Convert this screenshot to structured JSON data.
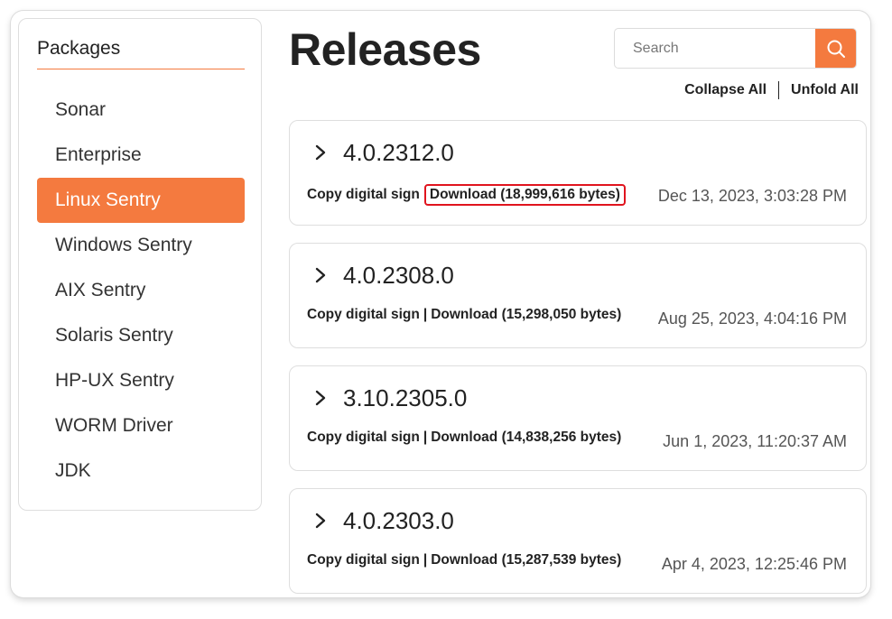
{
  "sidebar": {
    "title": "Packages",
    "items": [
      {
        "label": "Sonar",
        "active": false
      },
      {
        "label": "Enterprise",
        "active": false
      },
      {
        "label": "Linux Sentry",
        "active": true
      },
      {
        "label": "Windows Sentry",
        "active": false
      },
      {
        "label": "AIX Sentry",
        "active": false
      },
      {
        "label": "Solaris Sentry",
        "active": false
      },
      {
        "label": "HP-UX Sentry",
        "active": false
      },
      {
        "label": "WORM Driver",
        "active": false
      },
      {
        "label": "JDK",
        "active": false
      }
    ]
  },
  "header": {
    "title": "Releases",
    "search": {
      "placeholder": "Search",
      "value": ""
    },
    "collapse_label": "Collapse All",
    "unfold_label": "Unfold All"
  },
  "releases": [
    {
      "version": "4.0.2312.0",
      "copy_label": "Copy digital sign",
      "separator": "|",
      "download_label": "Download (18,999,616 bytes)",
      "date": "Dec 13, 2023, 3:03:28 PM",
      "highlighted": true
    },
    {
      "version": "4.0.2308.0",
      "copy_label": "Copy digital sign",
      "separator": "|",
      "download_label": "Download (15,298,050 bytes)",
      "date": "Aug 25, 2023, 4:04:16 PM",
      "highlighted": false
    },
    {
      "version": "3.10.2305.0",
      "copy_label": "Copy digital sign",
      "separator": "|",
      "download_label": "Download (14,838,256 bytes)",
      "date": "Jun 1, 2023, 11:20:37 AM",
      "highlighted": false
    },
    {
      "version": "4.0.2303.0",
      "copy_label": "Copy digital sign",
      "separator": "|",
      "download_label": "Download (15,287,539 bytes)",
      "date": "Apr 4, 2023, 12:25:46 PM",
      "highlighted": false
    }
  ],
  "icons": {
    "search": "search-icon",
    "expand": "chevron-right-icon"
  },
  "colors": {
    "accent": "#f47a3f",
    "highlight": "#e0141e"
  }
}
